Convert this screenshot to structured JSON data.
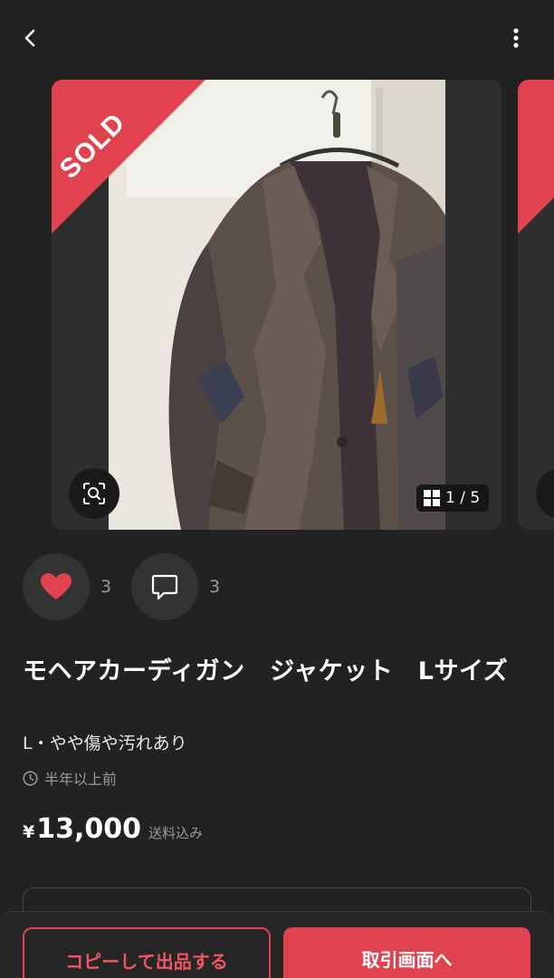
{
  "header": {
    "back_icon": "chevron-left-icon",
    "more_icon": "more-vertical-icon"
  },
  "gallery": {
    "sold_badge": "SOLD",
    "counter": "1 / 5",
    "zoom_icon": "scan-zoom-icon",
    "grid_icon": "grid-icon",
    "accent_color": "#e0424f"
  },
  "actions": {
    "like_icon": "heart-icon",
    "like_count": "3",
    "comment_icon": "comment-icon",
    "comment_count": "3"
  },
  "item": {
    "title": "モヘアカーディガン　ジャケット　Lサイズ",
    "condition": "L・やや傷や汚れあり",
    "clock_icon": "clock-icon",
    "posted": "半年以上前",
    "currency": "¥",
    "price": "13,000",
    "shipping": "送料込み"
  },
  "bottom": {
    "copy_label": "コピーして出品する",
    "trade_label": "取引画面へ"
  }
}
